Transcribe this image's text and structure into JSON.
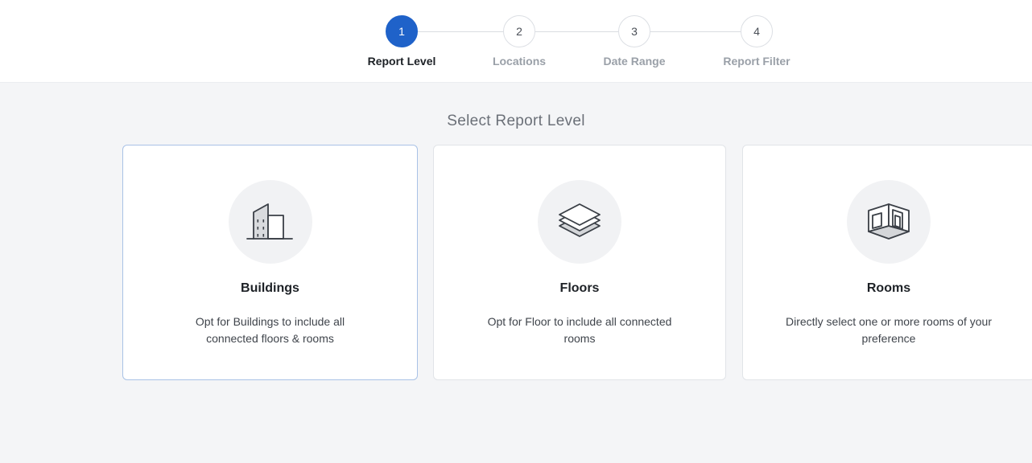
{
  "stepper": {
    "steps": [
      {
        "number": "1",
        "label": "Report Level"
      },
      {
        "number": "2",
        "label": "Locations"
      },
      {
        "number": "3",
        "label": "Date Range"
      },
      {
        "number": "4",
        "label": "Report Filter"
      }
    ],
    "active_step": "1"
  },
  "main": {
    "title": "Select Report Level",
    "cards": [
      {
        "icon": "building-icon",
        "title": "Buildings",
        "description": "Opt for Buildings to include all connected floors & rooms",
        "selected": true
      },
      {
        "icon": "layers-icon",
        "title": "Floors",
        "description": "Opt for Floor to include all connected rooms",
        "selected": false
      },
      {
        "icon": "room-icon",
        "title": "Rooms",
        "description": "Directly select one or more rooms of your preference",
        "selected": false
      }
    ]
  },
  "colors": {
    "accent": "#1f62c9",
    "selected_border": "#a9c2e6",
    "background": "#f4f5f7"
  }
}
